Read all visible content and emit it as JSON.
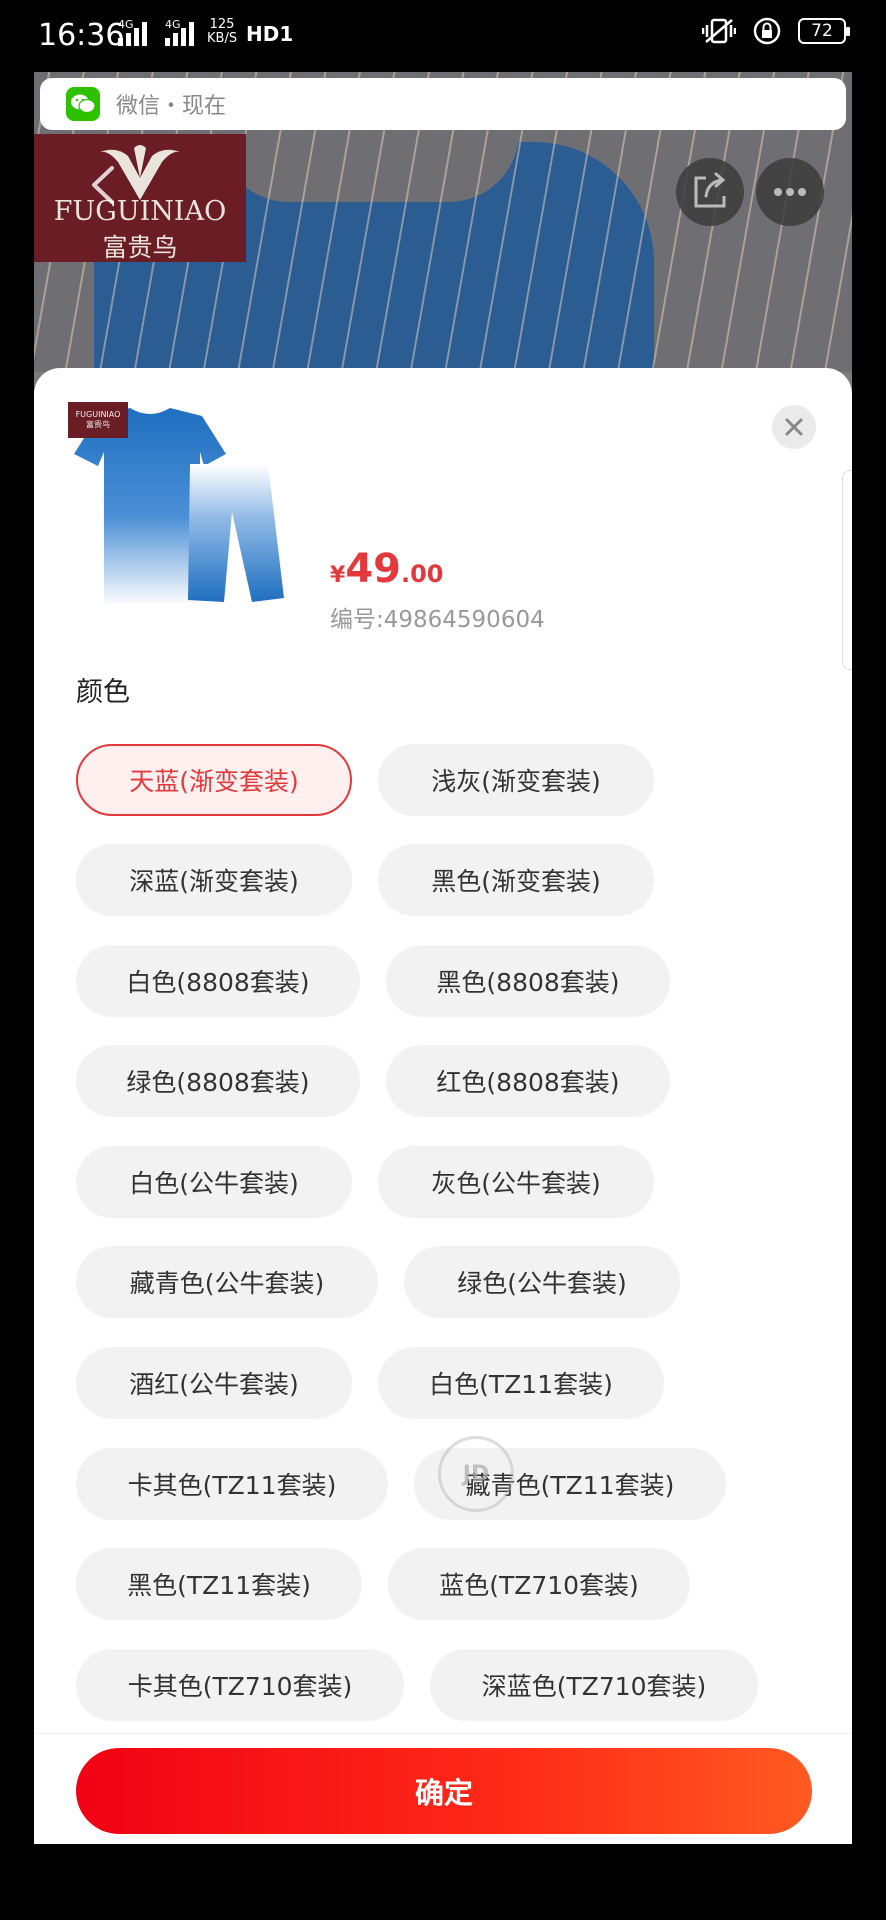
{
  "status_bar": {
    "time": "16:36",
    "signal1_tag": "4G",
    "signal2_tag": "4G",
    "speed_value": "125",
    "speed_unit": "KB/S",
    "hd_label": "HD1",
    "battery": "72"
  },
  "notification": {
    "app_text": "微信・现在"
  },
  "brand": {
    "name_en": "FUGUINIAO",
    "name_cn": "富贵鸟"
  },
  "product": {
    "price_symbol": "¥",
    "price_int": "49",
    "price_dec": ".00",
    "sku": "编号:49864590604"
  },
  "colors": {
    "title": "颜色",
    "options": [
      "天蓝(渐变套装)",
      "浅灰(渐变套装)",
      "深蓝(渐变套装)",
      "黑色(渐变套装)",
      "白色(8808套装)",
      "黑色(8808套装)",
      "绿色(8808套装)",
      "红色(8808套装)",
      "白色(公牛套装)",
      "灰色(公牛套装)",
      "藏青色(公牛套装)",
      "绿色(公牛套装)",
      "酒红(公牛套装)",
      "白色(TZ11套装)",
      "卡其色(TZ11套装)",
      "藏青色(TZ11套装)",
      "黑色(TZ11套装)",
      "蓝色(TZ710套装)",
      "卡其色(TZ710套装)",
      "深蓝色(TZ710套装)"
    ],
    "selected": "天蓝(渐变套装)"
  },
  "confirm_label": "确定",
  "loader_text": "JD",
  "theme": {
    "accent": "#e4393c",
    "button_gradient_start": "#f10215",
    "button_gradient_end": "#ff5a21",
    "brand_red": "#6b1d26",
    "wechat_green": "#2dc100"
  }
}
